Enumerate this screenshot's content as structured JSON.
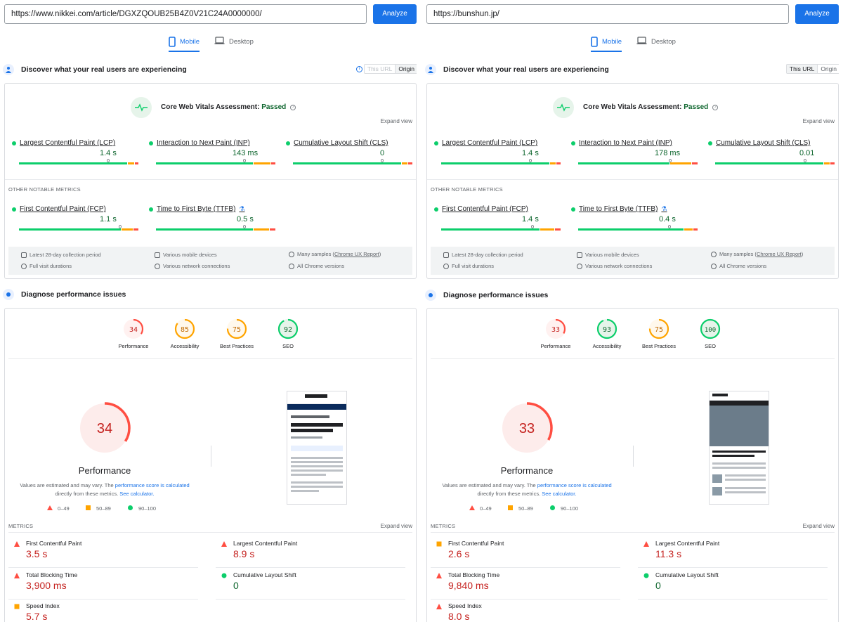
{
  "legend": {
    "bad": "0–49",
    "average": "50–89",
    "good": "90–100"
  },
  "labels": {
    "analyze": "Analyze",
    "mobile": "Mobile",
    "desktop": "Desktop",
    "discover": "Discover what your real users are experiencing",
    "this_url": "This URL",
    "origin": "Origin",
    "cwv_assessment": "Core Web Vitals Assessment:",
    "expand_view": "Expand view",
    "other_metrics": "OTHER NOTABLE METRICS",
    "lcp": "Largest Contentful Paint (LCP)",
    "inp": "Interaction to Next Paint (INP)",
    "cls": "Cumulative Layout Shift (CLS)",
    "fcp": "First Contentful Paint (FCP)",
    "ttfb": "Time to First Byte (TTFB)",
    "collection_period": "Latest 28-day collection period",
    "devices": "Various mobile devices",
    "samples": "Many samples (",
    "crux_link": "Chrome UX Report",
    "samples_end": ")",
    "durations": "Full visit durations",
    "network": "Various network connections",
    "chrome_versions": "All Chrome versions",
    "diagnose": "Diagnose performance issues",
    "cat_performance": "Performance",
    "cat_accessibility": "Accessibility",
    "cat_best_practices": "Best Practices",
    "cat_seo": "SEO",
    "perf_title": "Performance",
    "note_a": "Values are estimated and may vary. The ",
    "note_link1": "performance score is calculated",
    "note_b": " directly from these metrics. ",
    "note_link2": "See calculator.",
    "metrics": "METRICS",
    "lab_fcp": "First Contentful Paint",
    "lab_lcp": "Largest Contentful Paint",
    "lab_tbt": "Total Blocking Time",
    "lab_cls": "Cumulative Layout Shift",
    "lab_si": "Speed Index"
  },
  "panels": [
    {
      "url": "https://www.nikkei.com/article/DGXZQOUB25B4Z0V21C24A0000000/",
      "cwv_status": "Passed",
      "field": {
        "lcp": "1.4 s",
        "inp": "143 ms",
        "cls": "0",
        "fcp": "1.1 s",
        "ttfb": "0.5 s"
      },
      "scores": {
        "performance": "34",
        "accessibility": "85",
        "best_practices": "75",
        "seo": "92"
      },
      "lab": {
        "fcp": "3.5 s",
        "lcp": "8.9 s",
        "tbt": "3,900 ms",
        "cls": "0",
        "si": "5.7 s"
      }
    },
    {
      "url": "https://bunshun.jp/",
      "cwv_status": "Passed",
      "field": {
        "lcp": "1.4 s",
        "inp": "178 ms",
        "cls": "0.01",
        "fcp": "1.4 s",
        "ttfb": "0.4 s"
      },
      "scores": {
        "performance": "33",
        "accessibility": "93",
        "best_practices": "75",
        "seo": "100"
      },
      "lab": {
        "fcp": "2.6 s",
        "lcp": "11.3 s",
        "tbt": "9,840 ms",
        "cls": "0",
        "si": "8.0 s"
      }
    }
  ],
  "colors": {
    "accent": "#1a73e8",
    "good": "#0cce6b",
    "average": "#ffa400",
    "bad": "#ff4e42"
  }
}
